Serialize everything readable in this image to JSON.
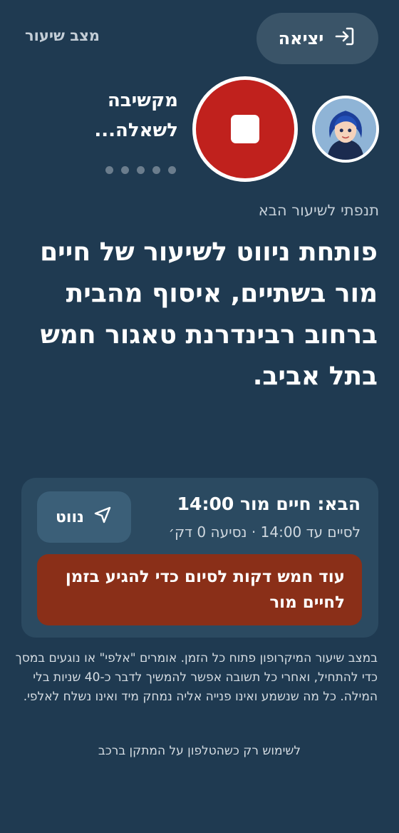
{
  "header": {
    "exit_label": "יציאה",
    "mode_label": "מצב שיעור"
  },
  "listening": {
    "status_text": "מקשיבה לשאלה...",
    "dots_count": 5
  },
  "next_lesson": {
    "label": "תנפתי לשיעור הבא",
    "message": "פותחת ניווט לשיעור של חיים מור בשתיים, איסוף מהבית ברחוב רבינדרנת טאגור חמש בתל אביב."
  },
  "card": {
    "title": "הבא: חיים מור 14:00",
    "subtitle": "לסיים עד 14:00 · נסיעה 0 דק׳",
    "nav_button_label": "נווט",
    "warning": "עוד חמש דקות לסיום כדי להגיע בזמן לחיים מור"
  },
  "description": "במצב שיעור המיקרופון פתוח כל הזמן. אומרים \"אלפי\" או נוגעים במסך כדי להתחיל, ואחרי כל תשובה אפשר להמשיך לדבר כ-40 שניות בלי המילה. כל מה שנשמע ואינו פנייה אליה נמחק מיד ואינו נשלח לאלפי.",
  "footnote": "לשימוש רק כשהטלפון על המתקן ברכב",
  "colors": {
    "background": "#1f3a51",
    "stop_button": "#c0211d",
    "warning_bg": "#8a2f18",
    "card_bg": "#2b4a61"
  }
}
